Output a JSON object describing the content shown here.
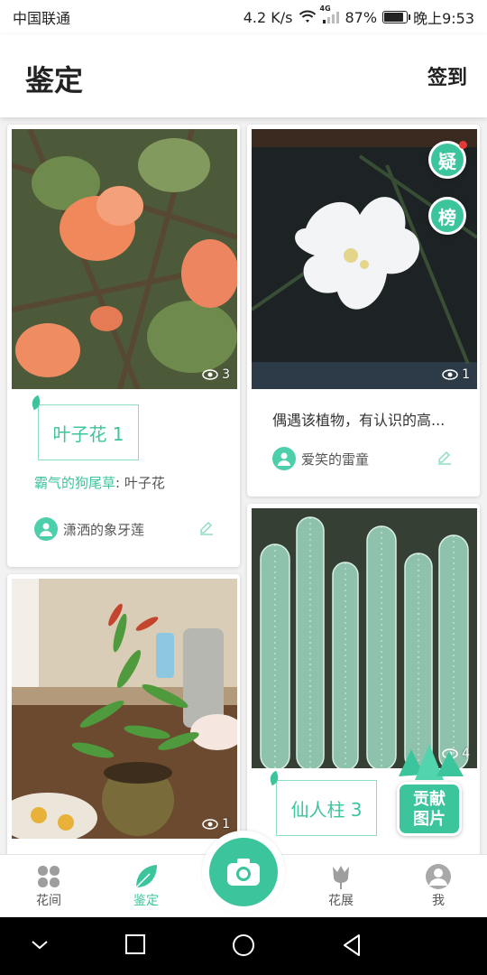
{
  "status": {
    "carrier": "中国联通",
    "speed": "4.2 K/s",
    "network": "4G",
    "battery": "87%",
    "battery_level": 0.87,
    "time": "晚上9:53"
  },
  "header": {
    "title": "鉴定",
    "checkin": "签到"
  },
  "floating": {
    "doubt": "疑",
    "rank": "榜",
    "contribute_line1": "贡献",
    "contribute_line2": "图片"
  },
  "cards": [
    {
      "views": "3",
      "plant": "叶子花 1",
      "answerer": "霸气的狗尾草",
      "answer": ": 叶子花",
      "user": "潇洒的象牙莲"
    },
    {
      "views": "1",
      "question": "偶遇该植物，有认识的高...",
      "user": "爱笑的雷童"
    },
    {
      "views": "1"
    },
    {
      "views": "4",
      "plant": "仙人柱 3"
    }
  ],
  "tabs": [
    {
      "label": "花间",
      "icon": "flower-grid-icon"
    },
    {
      "label": "鉴定",
      "icon": "leaf-icon"
    },
    {
      "label": "花展",
      "icon": "tulip-icon"
    },
    {
      "label": "我",
      "icon": "profile-icon"
    }
  ],
  "colors": {
    "accent": "#3cc49d",
    "badge_red": "#e53935"
  }
}
